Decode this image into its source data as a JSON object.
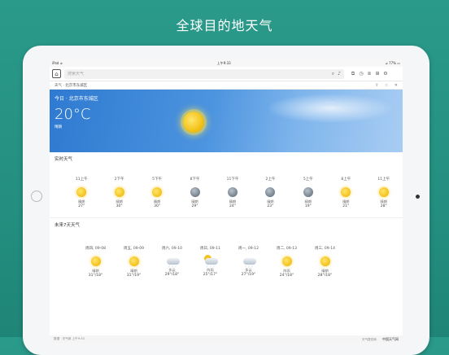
{
  "headline": "全球目的地天气",
  "statusbar": {
    "left": "iPad ≑",
    "time": "上午9:33",
    "right": "⊿ 77% ▭"
  },
  "navbar": {
    "search_placeholder": "搜索天气"
  },
  "subbar": {
    "path": "天气 · 北京市东城区"
  },
  "hero": {
    "location": "今日 · 北京市东城区",
    "temperature": "20°C",
    "condition": "晴朗",
    "info_line1": "·····  ·····",
    "info_line2": "·····  ·····"
  },
  "hourly_title": "实时天气",
  "hourly": [
    {
      "time": "11上午",
      "icon": "sun-icon",
      "cond": "晴朗",
      "temp": "27°"
    },
    {
      "time": "2下午",
      "icon": "sun-icon",
      "cond": "晴朗",
      "temp": "30°"
    },
    {
      "time": "5下午",
      "icon": "sun-icon",
      "cond": "晴朗",
      "temp": "30°"
    },
    {
      "time": "8下午",
      "icon": "moon-icon",
      "cond": "晴朗",
      "temp": "29°"
    },
    {
      "time": "11下午",
      "icon": "moon-icon",
      "cond": "晴朗",
      "temp": "24°"
    },
    {
      "time": "2上午",
      "icon": "moon-icon",
      "cond": "晴朗",
      "temp": "23°"
    },
    {
      "time": "5上午",
      "icon": "moon-icon",
      "cond": "晴朗",
      "temp": "19°"
    },
    {
      "time": "8上午",
      "icon": "sun-icon",
      "cond": "晴朗",
      "temp": "21°"
    },
    {
      "time": "11上午",
      "icon": "sun-icon",
      "cond": "晴朗",
      "temp": "28°"
    }
  ],
  "daily_title": "未来7天天气",
  "daily": [
    {
      "date": "周四, 09-08",
      "icon": "sun-icon",
      "cond": "晴朗",
      "temp": "31°/18°"
    },
    {
      "date": "周五, 09-09",
      "icon": "sun-icon",
      "cond": "晴朗",
      "temp": "31°/19°"
    },
    {
      "date": "周六, 09-10",
      "icon": "cloud-icon",
      "cond": "多云",
      "temp": "29°/18°"
    },
    {
      "date": "周日, 09-11",
      "icon": "sun-cloud-icon",
      "cond": "阵雨",
      "temp": "25°/17°"
    },
    {
      "date": "周一, 09-12",
      "icon": "cloud-icon",
      "cond": "多云",
      "temp": "27°/19°"
    },
    {
      "date": "周二, 09-13",
      "icon": "sun-icon",
      "cond": "阵雨",
      "temp": "24°/18°"
    },
    {
      "date": "周三, 09-14",
      "icon": "sun-icon",
      "cond": "晴朗",
      "temp": "28°/18°"
    }
  ],
  "footer": {
    "left": "数据 · 天气网 上午9:33",
    "right_note": "天气提供商",
    "brand": "中国天气网"
  }
}
